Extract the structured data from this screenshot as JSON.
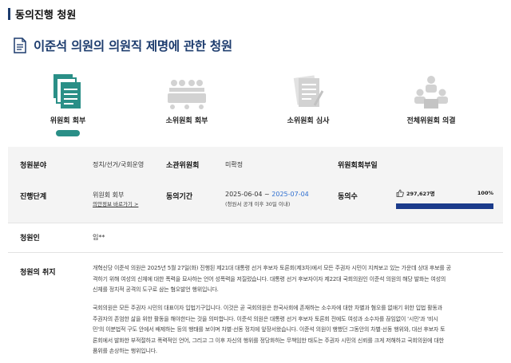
{
  "section_title": "동의진행 청원",
  "petition_title": "이준석 의원의 의원직 제명에 관한 청원",
  "steps": [
    {
      "label": "위원회 회부",
      "active": true,
      "icon": "documents-icon"
    },
    {
      "label": "소위원회 회부",
      "active": false,
      "icon": "meeting-table-icon"
    },
    {
      "label": "소위원회 심사",
      "active": false,
      "icon": "review-document-icon"
    },
    {
      "label": "전체위원회 의결",
      "active": false,
      "icon": "committee-icon"
    }
  ],
  "info": {
    "field_label": "청원분야",
    "field_value": "정치/선거/국회운영",
    "committee_label": "소관위원회",
    "committee_value": "미확정",
    "subcommittee_label": "위원회회부일",
    "subcommittee_value": "",
    "stage_label": "진행단계",
    "stage_value": "위원회 회부",
    "stage_link": "의안정보 바로가기 >",
    "period_label": "동의기간",
    "period_start": "2025-06-04 ~ ",
    "period_end": "2025-07-04",
    "period_note": "(청원서 공개 이후 30일 이내)",
    "votes_label": "동의수",
    "votes_count": "297,627명",
    "votes_percent": "100%",
    "votes_fill": 100,
    "petitioner_label": "청원인",
    "petitioner_value": "임**",
    "purpose_label": "청원의 취지",
    "purpose_paragraphs": [
      [
        "개혁신당 이준석 의원은 2025년 5월 27일(화) 진행된 제21대 대통령 선거 후보자 토론회(제3차)에서 모든 주권자 시민이 지켜보고 있는 가운데 상대 후보를 공",
        "격하기 위해 여성의 신체에 대한 폭력을 묘사하는 언어 성폭력을 저질렀습니다. 대통령 선거 후보자이자 제22대 국회의원인 이준석 의원의 해당 발화는 여성의",
        "신체를 정치적 공격의 도구로 삼는 혐오발언 행위입니다."
      ],
      [
        "국회의원은 모든 주권자 시민의 대표이자 입법기구입니다. 이것은 곧 국회의원은 한국사회에 존재하는 소수자에 대한 차별과 혐오를 없애기 위한 입법 활동과",
        "주권자의 존엄한 삶을 위한 활동을 해야한다는 것을 의미합니다. 이준석 의원은 대통령 선거 후보자 토론회 전에도 여성과 소수자를 끊임없이 '시민'과 '비시",
        "민'의 이분법적 구도 안에서 배제하는 등의 행태를 보이며 차별·선동 정치에 앞장서왔습니다. 이준석 의원이 행했던 그동안의 차별·선동 행위와, 대선 후보자 토",
        "론회에서 발화한 부적절하고 폭력적인 언어, 그리고 그 이후 자신의 행위를 정당화하는 무책임한 태도는 주권자 시민의 신뢰를 크게 저해하고 국회의원에 대한",
        "품위를 손상하는 행위입니다."
      ]
    ]
  }
}
